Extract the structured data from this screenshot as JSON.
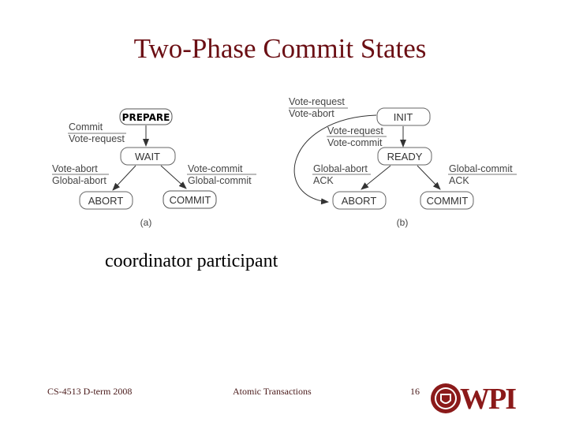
{
  "slide": {
    "title": "Two-Phase Commit States",
    "subtitle": "coordinator  participant",
    "footer": {
      "course": "CS-4513 D-term 2008",
      "topic": "Atomic Transactions",
      "page": "16"
    },
    "logo": {
      "text": "WPI",
      "icon": "wpi-seal-icon",
      "color": "#8b1a1a"
    }
  },
  "diagram_a": {
    "caption": "(a)",
    "states": {
      "prepare": "PREPARE",
      "wait": "WAIT",
      "abort": "ABORT",
      "commit": "COMMIT"
    },
    "transitions": {
      "prepare_wait": {
        "event": "Commit",
        "action": "Vote-request"
      },
      "wait_abort": {
        "event": "Vote-abort",
        "action": "Global-abort"
      },
      "wait_commit": {
        "event": "Vote-commit",
        "action": "Global-commit"
      }
    }
  },
  "diagram_b": {
    "caption": "(b)",
    "states": {
      "init": "INIT",
      "ready": "READY",
      "abort": "ABORT",
      "commit": "COMMIT"
    },
    "transitions": {
      "init_abort": {
        "event": "Vote-request",
        "action": "Vote-abort"
      },
      "init_ready": {
        "event": "Vote-request",
        "action": "Vote-commit"
      },
      "ready_abort": {
        "event": "Global-abort",
        "action": "ACK"
      },
      "ready_commit": {
        "event": "Global-commit",
        "action": "ACK"
      }
    }
  }
}
